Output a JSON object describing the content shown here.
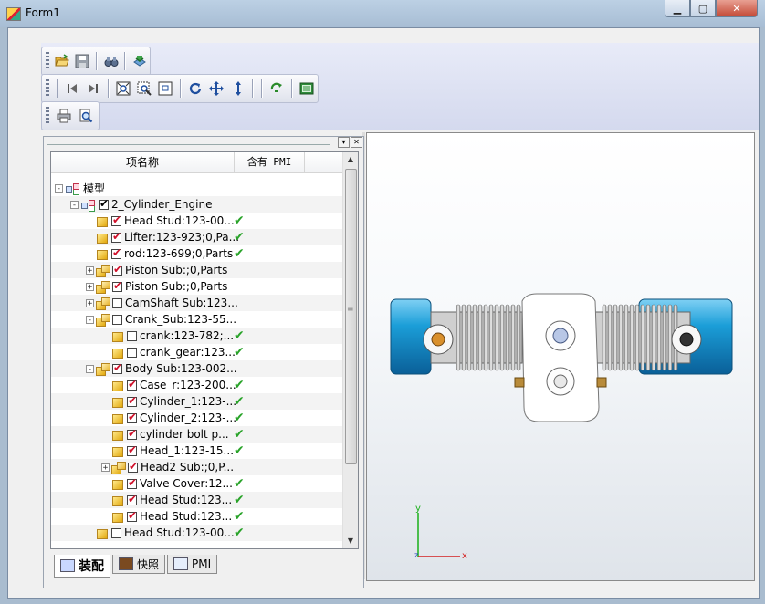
{
  "window": {
    "title": "Form1",
    "minimize_glyph": "▁",
    "maximize_glyph": "▢",
    "close_glyph": "✕"
  },
  "toolbars": {
    "row1": [
      "open-icon",
      "save-icon",
      "binoculars-icon",
      "import-icon"
    ],
    "row2": [
      "first-icon",
      "last-icon",
      "zoom-fit-icon",
      "zoom-window-icon",
      "zoom-area-icon",
      "rotate-icon",
      "pan-icon",
      "zoom-updown-icon",
      "refresh-icon",
      "panel-icon"
    ],
    "row3": [
      "print-icon",
      "print-preview-icon"
    ]
  },
  "dock": {
    "dropdown_glyph": "▾",
    "close_glyph": "✕"
  },
  "tree": {
    "columns": [
      "项名称",
      "含有 PMI"
    ],
    "check_glyph": "✔",
    "rows": [
      {
        "label": "模型",
        "level": 0,
        "exp": "-",
        "icon": "model",
        "checkbox": "none",
        "pmi": false
      },
      {
        "label": "2_Cylinder_Engine",
        "level": 1,
        "exp": "-",
        "icon": "model",
        "checkbox": "on-black",
        "pmi": false
      },
      {
        "label": "Head Stud:123-00...",
        "level": 2,
        "exp": "",
        "icon": "part",
        "checkbox": "on",
        "pmi": true
      },
      {
        "label": "Lifter:123-923;0,Pa...",
        "level": 2,
        "exp": "",
        "icon": "part",
        "checkbox": "on",
        "pmi": true
      },
      {
        "label": "rod:123-699;0,Parts",
        "level": 2,
        "exp": "",
        "icon": "part",
        "checkbox": "on",
        "pmi": true
      },
      {
        "label": "Piston Sub:;0,Parts",
        "level": 2,
        "exp": "+",
        "icon": "asm",
        "checkbox": "on",
        "pmi": false
      },
      {
        "label": "Piston Sub:;0,Parts",
        "level": 2,
        "exp": "+",
        "icon": "asm",
        "checkbox": "on",
        "pmi": false
      },
      {
        "label": "CamShaft Sub:123...",
        "level": 2,
        "exp": "+",
        "icon": "asm",
        "checkbox": "off",
        "pmi": false
      },
      {
        "label": "Crank_Sub:123-55...",
        "level": 2,
        "exp": "-",
        "icon": "asm",
        "checkbox": "off",
        "pmi": false
      },
      {
        "label": "crank:123-782;...",
        "level": 3,
        "exp": "",
        "icon": "part",
        "checkbox": "off",
        "pmi": true
      },
      {
        "label": "crank_gear:123...",
        "level": 3,
        "exp": "",
        "icon": "part",
        "checkbox": "off",
        "pmi": true
      },
      {
        "label": "Body Sub:123-002...",
        "level": 2,
        "exp": "-",
        "icon": "asm",
        "checkbox": "on",
        "pmi": false
      },
      {
        "label": "Case_r:123-200...",
        "level": 3,
        "exp": "",
        "icon": "part",
        "checkbox": "on",
        "pmi": true
      },
      {
        "label": "Cylinder_1:123-...",
        "level": 3,
        "exp": "",
        "icon": "part",
        "checkbox": "on",
        "pmi": true
      },
      {
        "label": "Cylinder_2:123-...",
        "level": 3,
        "exp": "",
        "icon": "part",
        "checkbox": "on",
        "pmi": true
      },
      {
        "label": "cylinder bolt p...",
        "level": 3,
        "exp": "",
        "icon": "part",
        "checkbox": "on",
        "pmi": true
      },
      {
        "label": "Head_1:123-15...",
        "level": 3,
        "exp": "",
        "icon": "part",
        "checkbox": "on",
        "pmi": true
      },
      {
        "label": "Head2 Sub:;0,P...",
        "level": 3,
        "exp": "+",
        "icon": "asm",
        "checkbox": "on",
        "pmi": false
      },
      {
        "label": "Valve Cover:12...",
        "level": 3,
        "exp": "",
        "icon": "part",
        "checkbox": "on",
        "pmi": true
      },
      {
        "label": "Head Stud:123...",
        "level": 3,
        "exp": "",
        "icon": "part",
        "checkbox": "on",
        "pmi": true
      },
      {
        "label": "Head Stud:123...",
        "level": 3,
        "exp": "",
        "icon": "part",
        "checkbox": "on",
        "pmi": true
      },
      {
        "label": "Head Stud:123-00...",
        "level": 2,
        "exp": "",
        "icon": "part",
        "checkbox": "off",
        "pmi": true
      }
    ]
  },
  "tabs": [
    {
      "label": "装配",
      "icon": "assembly-icon",
      "active": true
    },
    {
      "label": "快照",
      "icon": "snapshot-icon",
      "active": false
    },
    {
      "label": "PMI",
      "icon": "pmi-icon",
      "active": false
    }
  ],
  "viewer": {
    "axis_y": "y",
    "axis_x": "x",
    "axis_z": "z",
    "colors": {
      "cylinder_blue": "#1b9ed8",
      "fin_grey": "#c9c9c9",
      "body_white": "#ffffff"
    }
  }
}
